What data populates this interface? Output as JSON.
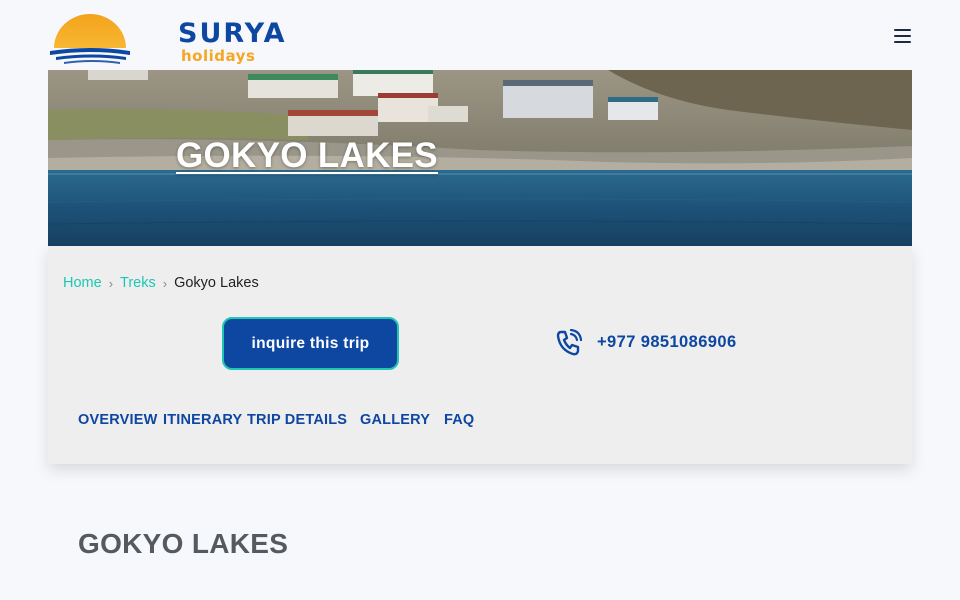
{
  "header": {
    "brand_name": "SURYA",
    "brand_tagline": "holidays",
    "menu_icon": "hamburger-menu-icon"
  },
  "hero": {
    "title": "GOKYO LAKES"
  },
  "breadcrumb": {
    "items": [
      {
        "label": "Home"
      },
      {
        "label": "Treks"
      },
      {
        "label": "Gokyo Lakes"
      }
    ],
    "separator_icon": "chevron-right-icon"
  },
  "actions": {
    "inquire_label": "inquire this trip",
    "phone_icon": "phone-ringing-icon",
    "phone_number": "+977 9851086906"
  },
  "tabs": [
    {
      "label": "OVERVIEW"
    },
    {
      "label": "ITINERARY"
    },
    {
      "label": "TRIP DETAILS"
    },
    {
      "label": "GALLERY"
    },
    {
      "label": "FAQ"
    }
  ],
  "main": {
    "title": "GOKYO LAKES"
  },
  "colors": {
    "brand_blue": "#0d47a1",
    "accent_teal": "#1ec6b4",
    "logo_orange": "#f6a623",
    "page_bg": "#f6f8fb",
    "card_bg": "#eeeeee"
  }
}
